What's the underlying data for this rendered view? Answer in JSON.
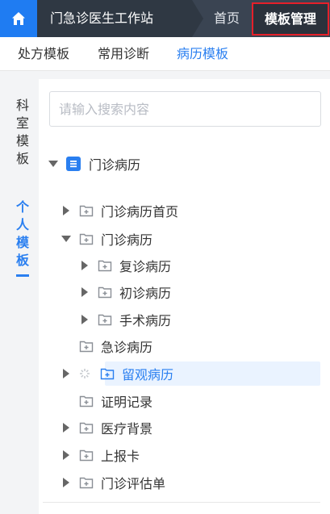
{
  "header": {
    "title": "门急诊医生工作站",
    "home_label": "首页",
    "active_label": "模板管理"
  },
  "subtabs": [
    "处方模板",
    "常用诊断",
    "病历模板"
  ],
  "sidetabs": {
    "dept": "科室模板",
    "personal": "个人模板"
  },
  "search": {
    "placeholder": "请输入搜索内容",
    "value": ""
  },
  "tree": {
    "root": "门诊病历",
    "items": [
      "门诊病历首页",
      "门诊病历",
      "复诊病历",
      "初诊病历",
      "手术病历",
      "急诊病历",
      "留观病历",
      "证明记录",
      "医疗背景",
      "上报卡",
      "门诊评估单"
    ]
  },
  "colors": {
    "accent": "#2a7ff0",
    "topbar": "#3a4452",
    "highlight_border": "#e6202a"
  }
}
